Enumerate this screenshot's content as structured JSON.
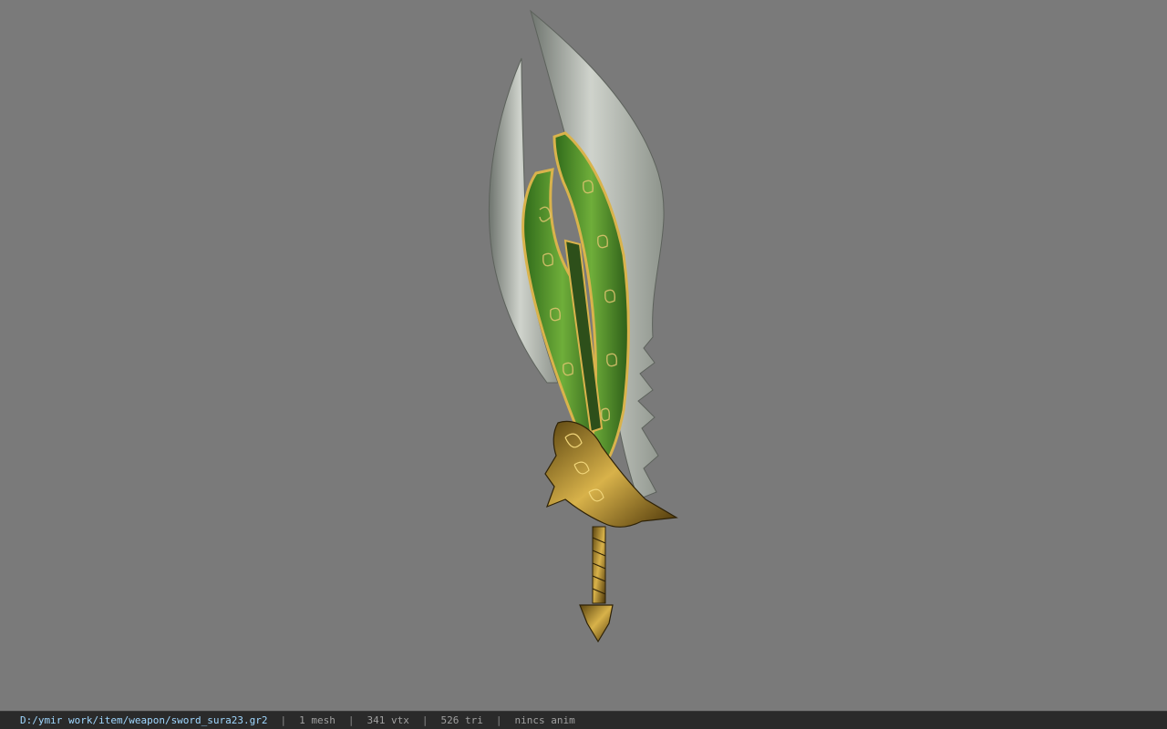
{
  "viewer": {
    "background_color": "#7a7a7a",
    "model_name": "sword_sura23",
    "model_icon": "sword-model"
  },
  "status": {
    "file_path": "D:/ymir work/item/weapon/sword_sura23.gr2",
    "separator": "|",
    "mesh_count": "1 mesh",
    "vertex_count": "341 vtx",
    "triangle_count": "526 tri",
    "anim_status": "nincs anim"
  }
}
